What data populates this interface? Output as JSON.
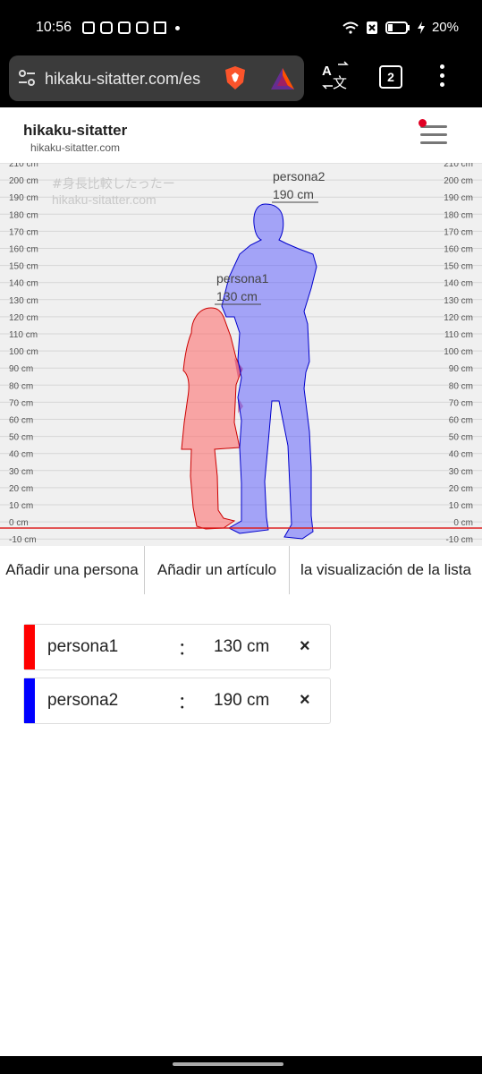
{
  "status_bar": {
    "time": "10:56",
    "battery": "20%",
    "icons": [
      "instagram-icon",
      "youtube-icon",
      "instagram-icon",
      "youtube-icon",
      "gmail-icon",
      "dot-icon"
    ]
  },
  "browser": {
    "url": "hikaku-sitatter.com/es",
    "tab_count": "2"
  },
  "site": {
    "title": "hikaku-sitatter",
    "subtitle": "hikaku-sitatter.com"
  },
  "chart": {
    "watermark_1": "#身長比較したったー",
    "watermark_2": "hikaku-sitatter.com",
    "ticks_left": [
      "210 cm",
      "200 cm",
      "190 cm",
      "180 cm",
      "170 cm",
      "160 cm",
      "150 cm",
      "140 cm",
      "130 cm",
      "120 cm",
      "110 cm",
      "100 cm",
      "90 cm",
      "80 cm",
      "70 cm",
      "60 cm",
      "50 cm",
      "40 cm",
      "30 cm",
      "20 cm",
      "10 cm",
      "0 cm",
      "-10 cm"
    ],
    "persons": [
      {
        "name": "persona1",
        "height_label": "130 cm",
        "height_cm": 130,
        "color": "#ff0000"
      },
      {
        "name": "persona2",
        "height_label": "190 cm",
        "height_cm": 190,
        "color": "#0000ff"
      }
    ]
  },
  "tabs": [
    {
      "label": "Añadir una persona"
    },
    {
      "label": "Añadir un artículo"
    },
    {
      "label": "la visualización de la lista"
    }
  ],
  "list": [
    {
      "name": "persona1",
      "separator": "：",
      "height": "130 cm",
      "remove": "×",
      "color": "#ff0000"
    },
    {
      "name": "persona2",
      "separator": "：",
      "height": "190 cm",
      "remove": "×",
      "color": "#0000ff"
    }
  ]
}
